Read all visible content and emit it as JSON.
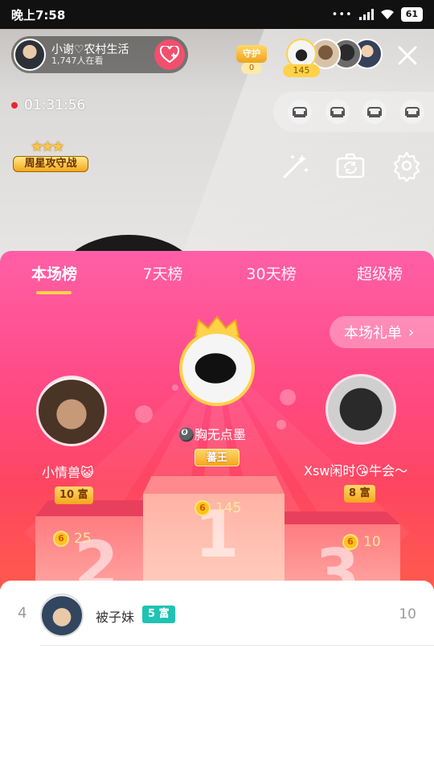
{
  "status_bar": {
    "time": "晚上7:58",
    "battery": "61",
    "signal_dots": "•••"
  },
  "host": {
    "name": "小谢♡农村生活",
    "viewers": "1,747人在看"
  },
  "guard": {
    "label": "守护",
    "count": "0"
  },
  "audience": {
    "badge": "145"
  },
  "timer": "01:31:56",
  "weekly_badge": {
    "label": "周星攻守战",
    "stars": "★★★"
  },
  "tabs": [
    "本场榜",
    "7天榜",
    "30天榜",
    "超级榜"
  ],
  "gift_list_label": "本场礼单",
  "gift_list_arrow": "›",
  "podium": {
    "first": {
      "name": "🎱胸无点墨",
      "title": "蕃王",
      "score": "145",
      "place": "1"
    },
    "second": {
      "name": "小情兽😺",
      "wealth": "10 富",
      "score": "25",
      "place": "2"
    },
    "third": {
      "name": "Xsw闲时😘牛会～",
      "wealth": "8 富",
      "score": "10",
      "place": "3"
    }
  },
  "coin_glyph": "6",
  "list": [
    {
      "rank": "4",
      "name": "被子妹",
      "badge": "5 富",
      "score": "10"
    }
  ],
  "colors": {
    "panel_top": "#ff5fa7",
    "panel_bottom": "#fe5a4c",
    "gold": "#ffd24a",
    "teal_badge": "#20c3b3"
  }
}
